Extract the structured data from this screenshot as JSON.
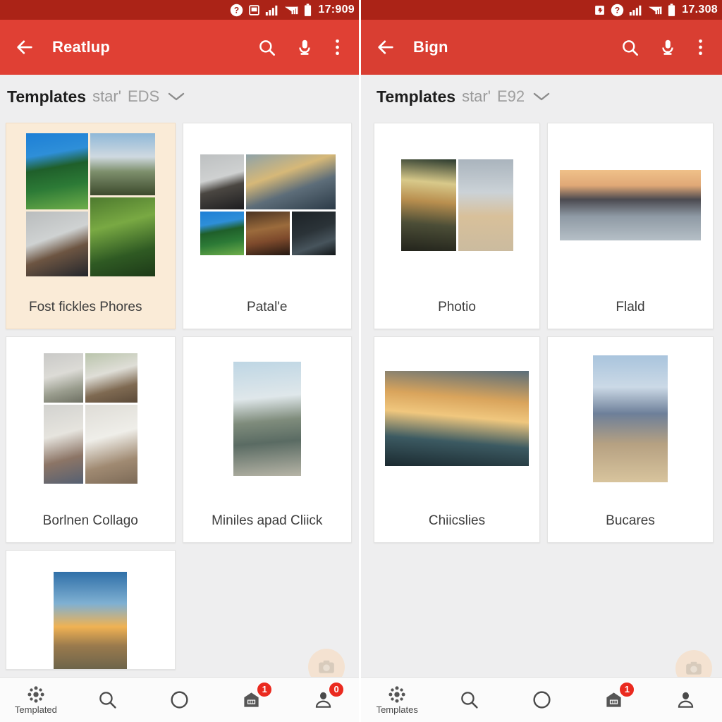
{
  "screens": [
    {
      "id": "left",
      "status_bar": {
        "time": "17:909",
        "icons": [
          "help-icon",
          "tablet-icon",
          "signal-bars-icon",
          "mobile-data-icon",
          "battery-icon"
        ]
      },
      "app_bar": {
        "back_icon": "arrow-back-icon",
        "title": "Reatlup",
        "actions": [
          "search-icon",
          "microphone-icon",
          "overflow-menu-icon"
        ],
        "background": "#e04034"
      },
      "section": {
        "title": "Templates",
        "sub1": "star'",
        "sub2": "EDS",
        "chevron": "chevron-down-icon"
      },
      "cards": [
        {
          "label": "Fost fickles Phores",
          "selected": true,
          "layout": "mosaic-4"
        },
        {
          "label": "Patal'e",
          "selected": false,
          "layout": "mosaic-5"
        },
        {
          "label": "Borlnen Collago",
          "selected": false,
          "layout": "mosaic-2x2"
        },
        {
          "label": "Miniles apad Cliick",
          "selected": false,
          "layout": "single-portrait"
        },
        {
          "label": "",
          "selected": false,
          "layout": "single-portrait-partial"
        }
      ],
      "bottom_nav": [
        {
          "label": "Templated",
          "icon": "templates-burst-icon",
          "badge": ""
        },
        {
          "label": "",
          "icon": "search-icon",
          "badge": ""
        },
        {
          "label": "",
          "icon": "circle-icon",
          "badge": ""
        },
        {
          "label": "",
          "icon": "store-icon",
          "badge": "1"
        },
        {
          "label": "",
          "icon": "person-icon",
          "badge": "0"
        }
      ],
      "fab": {
        "icon": "camera-fab-icon",
        "color": "#f8dcc0"
      }
    },
    {
      "id": "right",
      "status_bar": {
        "time": "17.308",
        "icons": [
          "sdcard-icon",
          "help-icon",
          "signal-bars-icon",
          "mobile-data-icon",
          "battery-icon"
        ]
      },
      "app_bar": {
        "back_icon": "arrow-back-icon",
        "title": "Bign",
        "actions": [
          "search-icon",
          "microphone-icon",
          "overflow-menu-icon"
        ],
        "background": "#d93e32"
      },
      "section": {
        "title": "Templates",
        "sub1": "star'",
        "sub2": "E92",
        "chevron": "chevron-down-icon"
      },
      "cards": [
        {
          "label": "Photio",
          "selected": false,
          "layout": "pair-portrait"
        },
        {
          "label": "Flald",
          "selected": false,
          "layout": "single-wide"
        },
        {
          "label": "Chiicslies",
          "selected": false,
          "layout": "single-landscape"
        },
        {
          "label": "Bucares",
          "selected": false,
          "layout": "single-portrait"
        }
      ],
      "bottom_nav": [
        {
          "label": "Templates",
          "icon": "templates-burst-icon",
          "badge": ""
        },
        {
          "label": "",
          "icon": "search-icon",
          "badge": ""
        },
        {
          "label": "",
          "icon": "circle-icon",
          "badge": ""
        },
        {
          "label": "",
          "icon": "store-icon",
          "badge": "1"
        },
        {
          "label": "",
          "icon": "person-icon",
          "badge": ""
        }
      ],
      "fab": {
        "icon": "camera-fab-icon",
        "color": "#f8dcc0"
      }
    }
  ],
  "theme": {
    "status_bar_color": "#ab2317",
    "app_bar_color": "#e04034",
    "selected_card_color": "#faebd7",
    "badge_color": "#ea2a1f",
    "page_background": "#eeeeef"
  }
}
